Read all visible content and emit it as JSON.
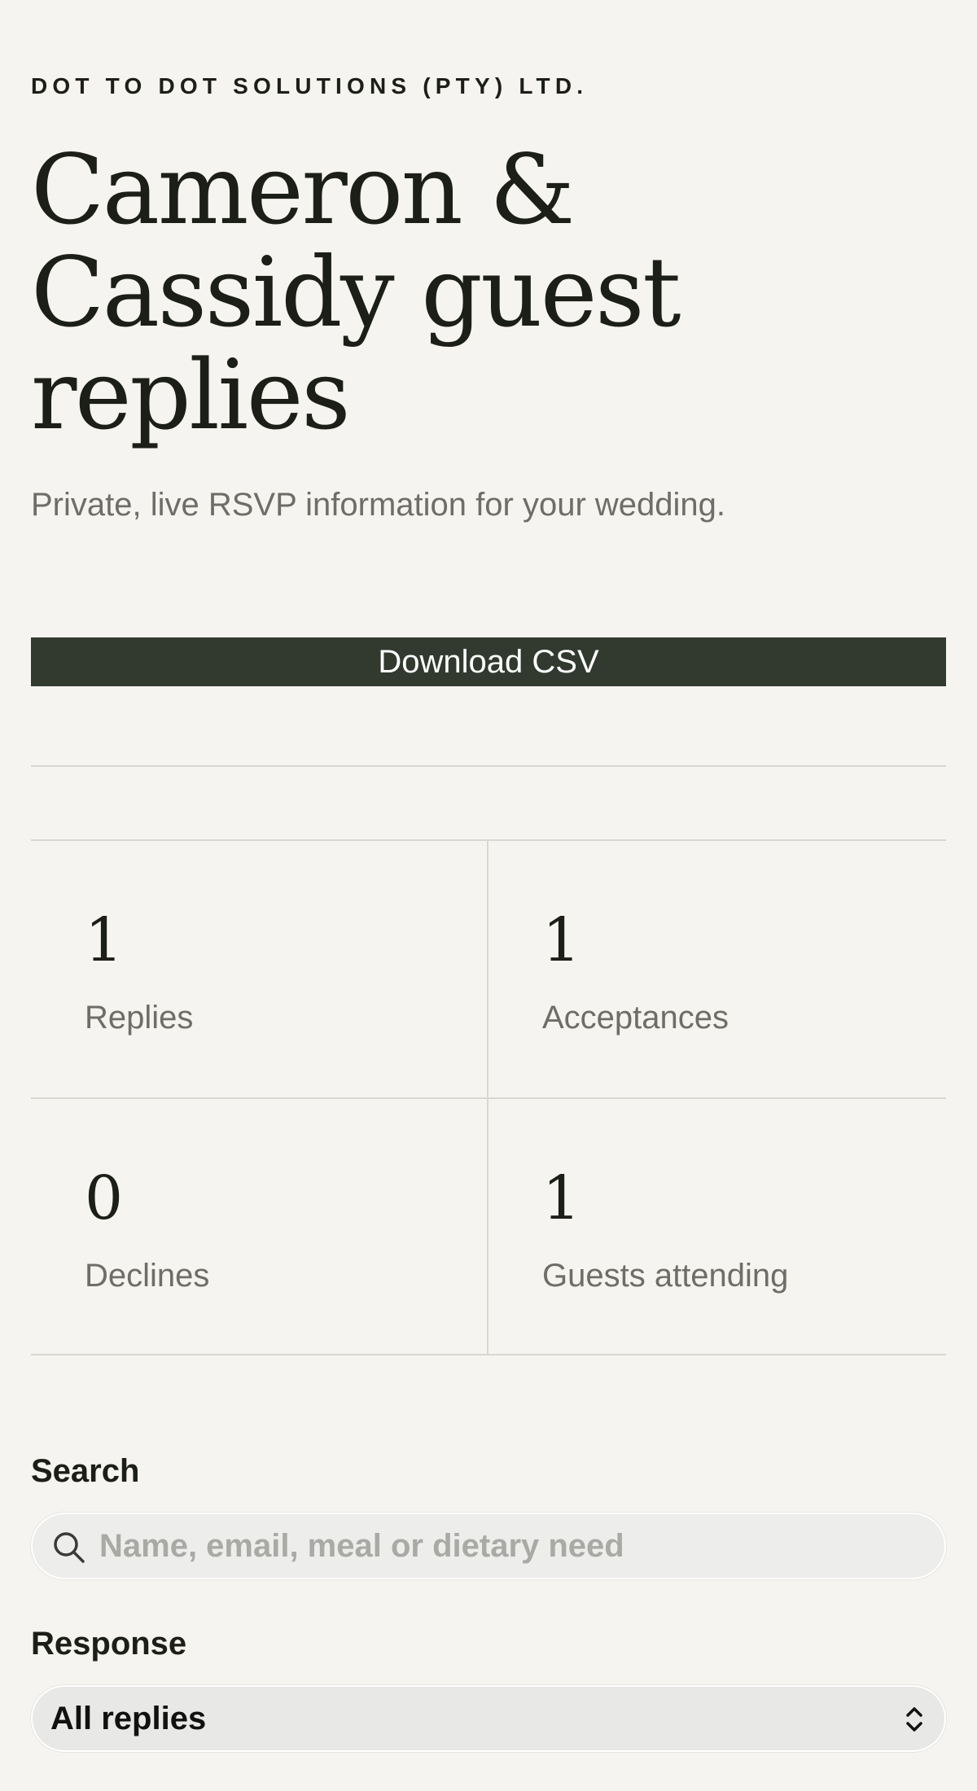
{
  "header": {
    "company": "DOT TO DOT SOLUTIONS (PTY) LTD.",
    "title": "Cameron & Cassidy guest replies",
    "subtitle": "Private, live RSVP information for your wedding."
  },
  "actions": {
    "download_label": "Download CSV"
  },
  "stats": [
    {
      "value": "1",
      "label": "Replies"
    },
    {
      "value": "1",
      "label": "Acceptances"
    },
    {
      "value": "0",
      "label": "Declines"
    },
    {
      "value": "1",
      "label": "Guests attending"
    }
  ],
  "filters": {
    "search_label": "Search",
    "search_placeholder": "Name, email, meal or dietary need",
    "search_value": "",
    "response_label": "Response",
    "response_selected": "All replies"
  },
  "colors": {
    "background": "#f5f4f0",
    "button": "#323a2f",
    "muted_text": "#6e6e68"
  },
  "icons": {
    "search": "search-icon",
    "select": "chevron-up-down-icon"
  }
}
